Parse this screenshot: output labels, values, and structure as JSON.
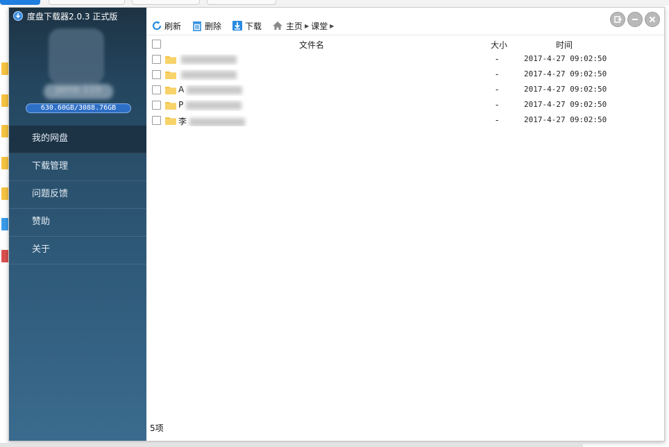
{
  "app": {
    "title": "度盘下载器2.0.3 正式版",
    "quota": "630.60GB/3088.76GB",
    "username": "Jame 115"
  },
  "sidebar": {
    "items": [
      {
        "label": "我的网盘",
        "active": true
      },
      {
        "label": "下载管理",
        "active": false
      },
      {
        "label": "问题反馈",
        "active": false
      },
      {
        "label": "赞助",
        "active": false
      },
      {
        "label": "关于",
        "active": false
      }
    ]
  },
  "toolbar": {
    "refresh": "刷新",
    "delete": "删除",
    "download": "下载",
    "home": "主页",
    "crumb": "课堂"
  },
  "table": {
    "headers": {
      "name": "文件名",
      "size": "大小",
      "time": "时间"
    },
    "rows": [
      {
        "name": "",
        "size": "-",
        "time": "2017-4-27 09:02:50"
      },
      {
        "name": "",
        "size": "-",
        "time": "2017-4-27 09:02:50"
      },
      {
        "name": "A",
        "size": "-",
        "time": "2017-4-27 09:02:50"
      },
      {
        "name": "P",
        "size": "-",
        "time": "2017-4-27 09:02:50"
      },
      {
        "name": "李",
        "size": "-",
        "time": "2017-4-27 09:02:50"
      }
    ]
  },
  "status": {
    "count": "5项"
  },
  "colors": {
    "sidebar_top": "#1d3344",
    "sidebar_bottom": "#3a6b8e",
    "quota_bar": "#2e6fc6",
    "folder": "#f5c242",
    "accent": "#1f7ee0"
  },
  "icons": [
    "refresh-icon",
    "trash-icon",
    "download-icon",
    "home-icon",
    "folder-icon",
    "restore-icon",
    "minimize-icon",
    "close-icon",
    "app-logo-icon"
  ]
}
